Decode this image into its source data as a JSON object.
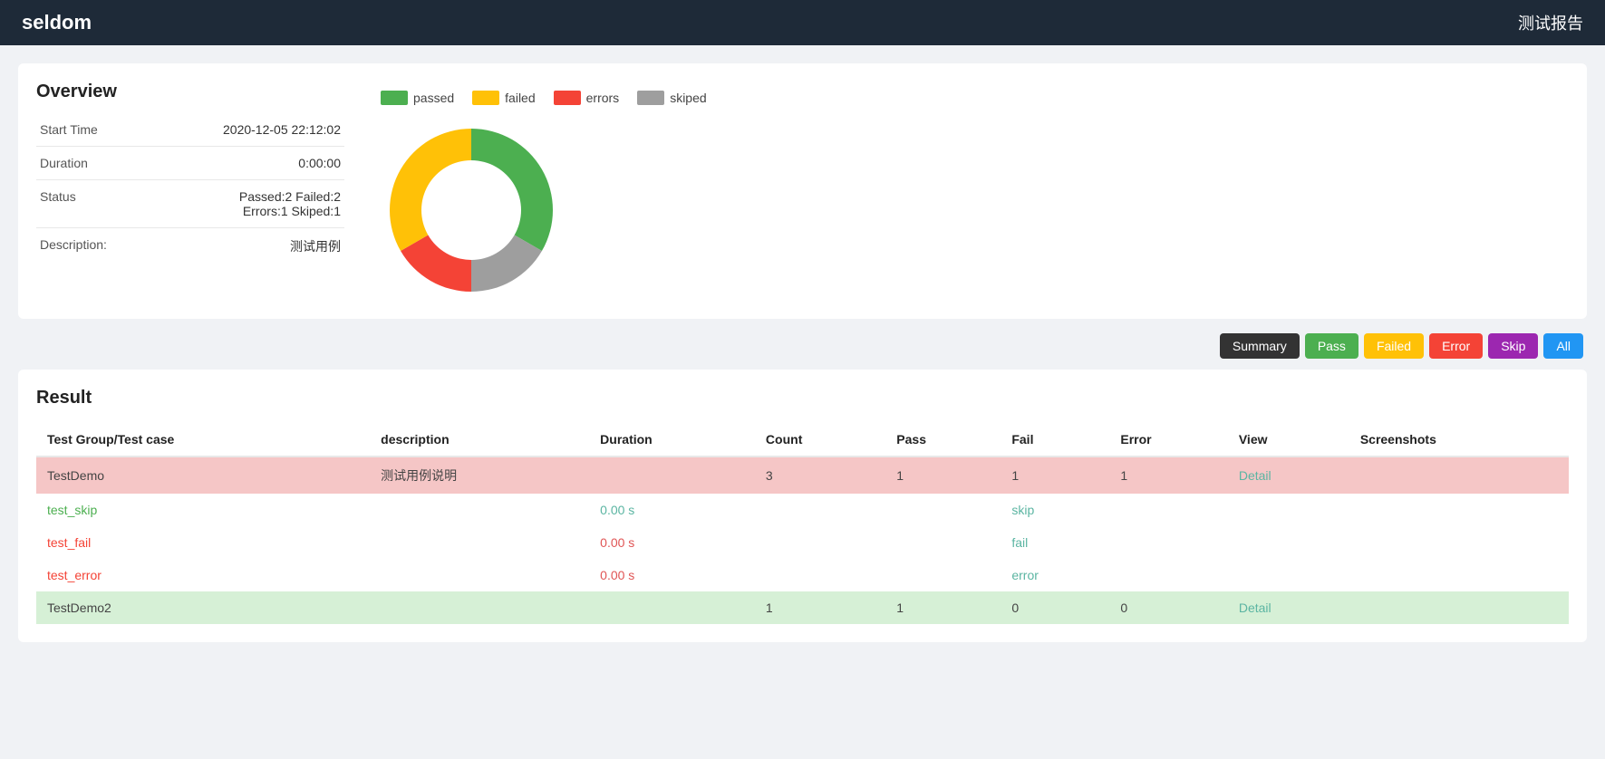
{
  "header": {
    "brand": "seldom",
    "report_title": "测试报告"
  },
  "overview": {
    "title": "Overview",
    "rows": [
      {
        "label": "Start Time",
        "value": "2020-12-05 22:12:02"
      },
      {
        "label": "Duration",
        "value": "0:00:00"
      },
      {
        "label": "Status",
        "value": "Passed:2 Failed:2\nErrors:1 Skiped:1"
      },
      {
        "label": "Description:",
        "value": "测试用例"
      }
    ]
  },
  "legend": [
    {
      "name": "passed",
      "color": "#4caf50"
    },
    {
      "name": "failed",
      "color": "#ffc107"
    },
    {
      "name": "errors",
      "color": "#f44336"
    },
    {
      "name": "skiped",
      "color": "#9e9e9e"
    }
  ],
  "chart": {
    "passed": 2,
    "failed": 2,
    "errors": 1,
    "skiped": 1,
    "total": 6
  },
  "filter_buttons": [
    {
      "label": "Summary",
      "color": "#333333",
      "key": "summary"
    },
    {
      "label": "Pass",
      "color": "#4caf50",
      "key": "pass"
    },
    {
      "label": "Failed",
      "color": "#ffc107",
      "key": "failed"
    },
    {
      "label": "Error",
      "color": "#f44336",
      "key": "error"
    },
    {
      "label": "Skip",
      "color": "#9c27b0",
      "key": "skip"
    },
    {
      "label": "All",
      "color": "#2196f3",
      "key": "all"
    }
  ],
  "result": {
    "title": "Result",
    "columns": [
      "Test Group/Test case",
      "description",
      "Duration",
      "Count",
      "Pass",
      "Fail",
      "Error",
      "View",
      "Screenshots"
    ],
    "rows": [
      {
        "type": "group-failed",
        "name": "TestDemo",
        "description": "测试用例说明",
        "duration": "",
        "count": "3",
        "pass": "1",
        "fail": "1",
        "error": "1",
        "view": "Detail",
        "screenshots": ""
      },
      {
        "type": "case-skip",
        "name": "test_skip",
        "description": "",
        "duration": "0.00 s",
        "count": "",
        "pass": "",
        "fail": "skip",
        "error": "",
        "view": "",
        "screenshots": ""
      },
      {
        "type": "case-fail",
        "name": "test_fail",
        "description": "",
        "duration": "0.00 s",
        "count": "",
        "pass": "",
        "fail": "fail",
        "error": "",
        "view": "",
        "screenshots": ""
      },
      {
        "type": "case-error",
        "name": "test_error",
        "description": "",
        "duration": "0.00 s",
        "count": "",
        "pass": "",
        "fail": "error",
        "error": "",
        "view": "",
        "screenshots": ""
      },
      {
        "type": "group-passed",
        "name": "TestDemo2",
        "description": "",
        "duration": "",
        "count": "1",
        "pass": "1",
        "fail": "0",
        "error": "0",
        "view": "Detail",
        "screenshots": ""
      }
    ]
  }
}
